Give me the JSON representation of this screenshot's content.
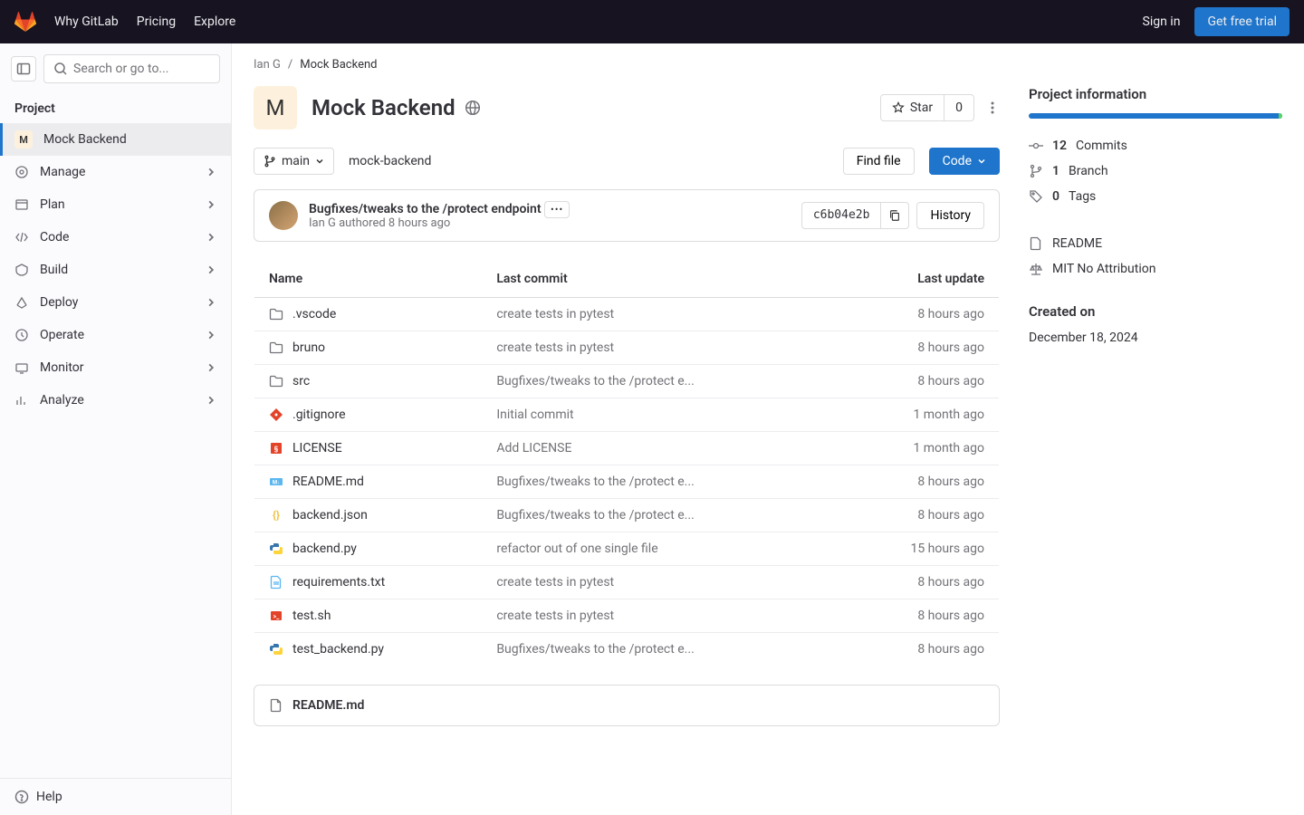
{
  "topbar": {
    "links": [
      "Why GitLab",
      "Pricing",
      "Explore"
    ],
    "signin": "Sign in",
    "trial": "Get free trial"
  },
  "sidebar": {
    "search_placeholder": "Search or go to...",
    "section": "Project",
    "project_initial": "M",
    "project_name": "Mock Backend",
    "items": [
      "Manage",
      "Plan",
      "Code",
      "Build",
      "Deploy",
      "Operate",
      "Monitor",
      "Analyze"
    ],
    "help": "Help"
  },
  "breadcrumb": {
    "owner": "Ian G",
    "project": "Mock Backend"
  },
  "project": {
    "initial": "M",
    "name": "Mock Backend",
    "star_label": "Star",
    "star_count": "0",
    "branch": "main",
    "path": "mock-backend",
    "find_file": "Find file",
    "code_btn": "Code"
  },
  "commit": {
    "message": "Bugfixes/tweaks to the /protect endpoint",
    "author": "Ian G",
    "authored": "authored",
    "time": "8 hours ago",
    "sha": "c6b04e2b",
    "history": "History"
  },
  "table": {
    "headers": [
      "Name",
      "Last commit",
      "Last update"
    ],
    "rows": [
      {
        "type": "folder",
        "name": ".vscode",
        "commit": "create tests in pytest",
        "time": "8 hours ago"
      },
      {
        "type": "folder",
        "name": "bruno",
        "commit": "create tests in pytest",
        "time": "8 hours ago"
      },
      {
        "type": "folder",
        "name": "src",
        "commit": "Bugfixes/tweaks to the /protect e...",
        "time": "8 hours ago"
      },
      {
        "type": "gitignore",
        "name": ".gitignore",
        "commit": "Initial commit",
        "time": "1 month ago"
      },
      {
        "type": "license",
        "name": "LICENSE",
        "commit": "Add LICENSE",
        "time": "1 month ago"
      },
      {
        "type": "md",
        "name": "README.md",
        "commit": "Bugfixes/tweaks to the /protect e...",
        "time": "8 hours ago"
      },
      {
        "type": "json",
        "name": "backend.json",
        "commit": "Bugfixes/tweaks to the /protect e...",
        "time": "8 hours ago"
      },
      {
        "type": "python",
        "name": "backend.py",
        "commit": "refactor out of one single file",
        "time": "15 hours ago"
      },
      {
        "type": "txt",
        "name": "requirements.txt",
        "commit": "create tests in pytest",
        "time": "8 hours ago"
      },
      {
        "type": "sh",
        "name": "test.sh",
        "commit": "create tests in pytest",
        "time": "8 hours ago"
      },
      {
        "type": "python",
        "name": "test_backend.py",
        "commit": "Bugfixes/tweaks to the /protect e...",
        "time": "8 hours ago"
      }
    ]
  },
  "readme": {
    "label": "README.md"
  },
  "info": {
    "title": "Project information",
    "commits_n": "12",
    "commits": "Commits",
    "branches_n": "1",
    "branches": "Branch",
    "tags_n": "0",
    "tags": "Tags",
    "readme": "README",
    "license": "MIT No Attribution",
    "created_title": "Created on",
    "created": "December 18, 2024"
  }
}
